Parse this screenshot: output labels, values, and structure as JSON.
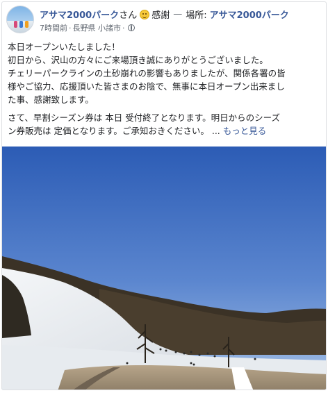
{
  "post": {
    "page_name": "アサマ2000パーク",
    "suffix_san": "さん",
    "feeling": "感謝",
    "dash": "—",
    "location_prefix": "場所:",
    "location_name": "アサマ2000パーク",
    "time": "7時間前",
    "dot": "·",
    "place": "長野県 小諸市",
    "paragraph1_lines": [
      "本日オープンいたしました！",
      "初日から、沢山の方々にご来場頂き誠にありがとうございました。",
      "チェリーパークラインの土砂崩れの影響もありましたが、関係各署の皆",
      "様やご協力、応援頂いた皆さまのお陰で、無事に本日オープン出来まし",
      "た事、感謝致します。"
    ],
    "paragraph2_line1": "さて、早割シーズン券は 本日 受付終了となります。明日からのシーズ",
    "paragraph2_line2": "ン券販売は 定価となります。ご承知おきください。",
    "see_more_ellipsis": "...",
    "see_more": "もっと見る"
  },
  "colors": {
    "link": "#385898",
    "sky_top": "#2f5fb8",
    "sky_bottom": "#8fb3e2",
    "snow": "#eef1f4"
  },
  "icons": [
    "smile-emoji-icon",
    "globe-icon"
  ]
}
